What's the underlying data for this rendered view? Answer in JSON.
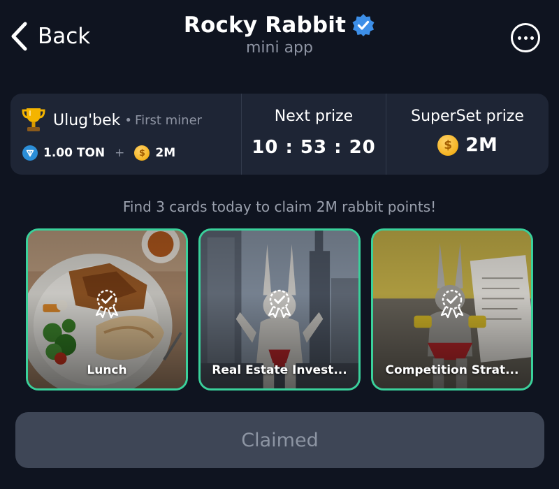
{
  "header": {
    "back_label": "Back",
    "title": "Rocky Rabbit",
    "subtitle": "mini app",
    "verified_icon": "verified-badge-icon",
    "more_icon": "more-horizontal-icon"
  },
  "stats": {
    "user": {
      "name": "Ulug'bek",
      "separator": "•",
      "role": "First miner",
      "ton_balance": "1.00 TON",
      "plus": "+",
      "coin_balance": "2M",
      "coin_symbol": "$"
    },
    "next_prize": {
      "label": "Next prize",
      "timer": "10 : 53 : 20"
    },
    "superset_prize": {
      "label": "SuperSet prize",
      "amount": "2M",
      "coin_symbol": "$"
    }
  },
  "instruction": "Find 3 cards today to claim 2M rabbit points!",
  "cards": [
    {
      "label": "Lunch"
    },
    {
      "label": "Real Estate Invest..."
    },
    {
      "label": "Competition Strat..."
    }
  ],
  "claim_button": {
    "label": "Claimed"
  },
  "colors": {
    "background": "#0f1420",
    "panel": "#1e2535",
    "accent_green": "#3ad19b",
    "verified_blue": "#3d8fe8",
    "button_disabled": "#3e4656",
    "muted_text": "#8e94a3"
  }
}
